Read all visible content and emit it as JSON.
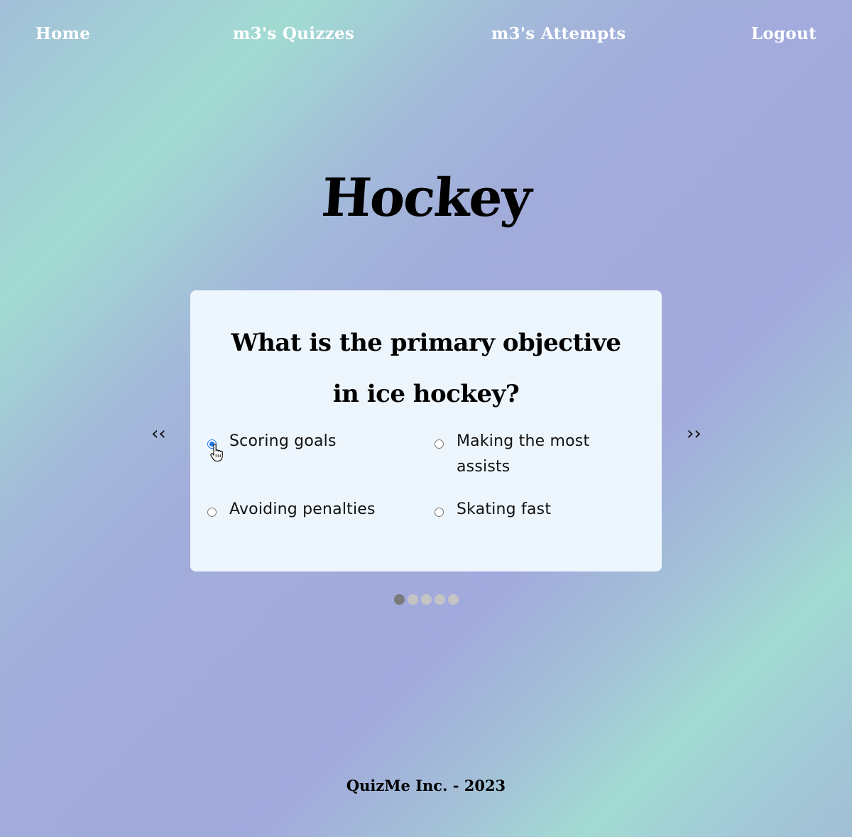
{
  "nav": {
    "home": "Home",
    "quizzes": "m3's Quizzes",
    "attempts": "m3's Attempts",
    "logout": "Logout"
  },
  "quiz": {
    "title": "Hockey",
    "question": "What is the primary objective in ice hockey?",
    "prev_arrow": "‹‹",
    "next_arrow": "››",
    "options": [
      {
        "label": "Scoring goals",
        "selected": true
      },
      {
        "label": "Making the most assists",
        "selected": false
      },
      {
        "label": "Avoiding penalties",
        "selected": false
      },
      {
        "label": "Skating fast",
        "selected": false
      }
    ],
    "pagination": {
      "total": 5,
      "current": 1
    }
  },
  "footer": {
    "text": "QuizMe Inc. - 2023"
  },
  "colors": {
    "radio_selected": "#1a73e8",
    "dot_active": "#7a7a7a",
    "dot_inactive": "#c4c4c4",
    "card_bg": "#eef6fd"
  }
}
